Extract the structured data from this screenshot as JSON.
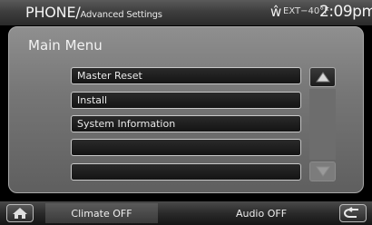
{
  "header": {
    "title": "PHONE/",
    "subtitle": "Advanced Settings",
    "wifi_glyph": "ŵ",
    "temperature": "EXT−40°F",
    "time": "2:09pm"
  },
  "main": {
    "menu_title": "Main Menu",
    "items": [
      {
        "label": "Master Reset"
      },
      {
        "label": "Install"
      },
      {
        "label": "System Information"
      },
      {
        "label": ""
      },
      {
        "label": ""
      }
    ],
    "scroll_up_icon": "triangle-up-icon",
    "scroll_down_icon": "triangle-down-icon"
  },
  "footer": {
    "home_icon": "home-icon",
    "climate_label": "Climate OFF",
    "audio_label": "Audio OFF",
    "back_icon": "back-arrow-icon"
  }
}
